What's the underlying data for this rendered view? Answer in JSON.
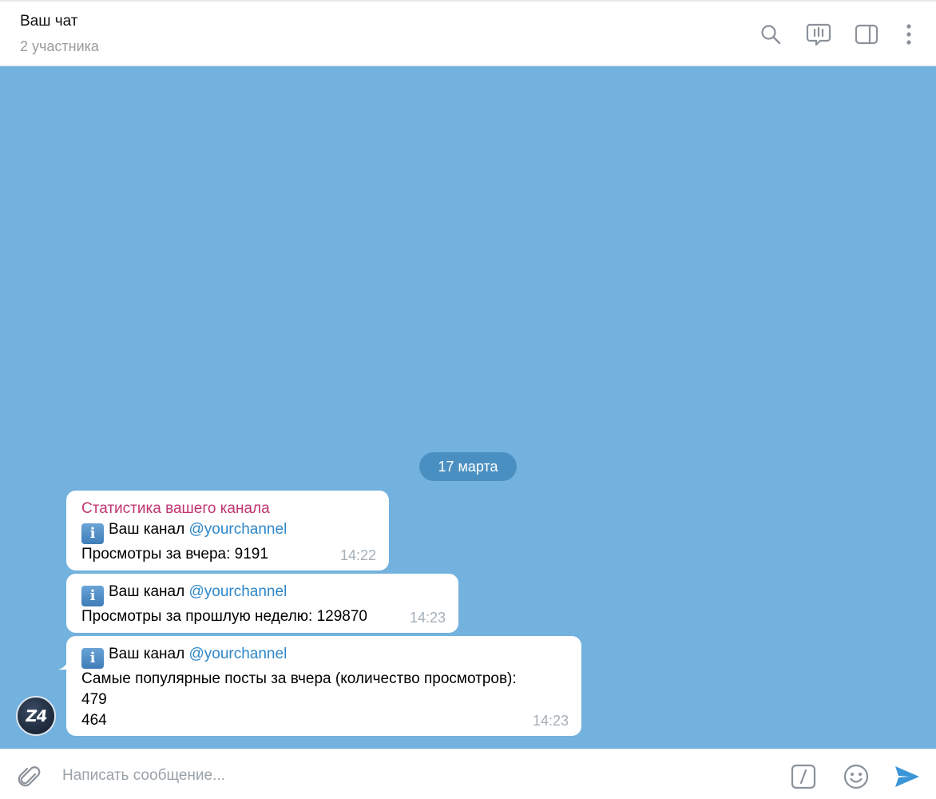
{
  "header": {
    "title": "Ваш чат",
    "subtitle": "2 участника",
    "icons": [
      "search-icon",
      "voice-chat-icon",
      "sidebar-toggle-icon",
      "more-icon"
    ]
  },
  "chat": {
    "background_color": "#73b2de",
    "date_label": "17 марта",
    "avatar_text": "Z4",
    "messages": [
      {
        "sender": "Статистика вашего канала",
        "lines": [
          {
            "prefix": "Ваш канал ",
            "link": "@yourchannel"
          },
          {
            "text": "Просмотры за вчера: 9191"
          }
        ],
        "time": "14:22"
      },
      {
        "lines": [
          {
            "prefix": "Ваш канал ",
            "link": "@yourchannel"
          },
          {
            "text": "Просмотры за прошлую неделю: 129870"
          }
        ],
        "time": "14:23"
      },
      {
        "lines": [
          {
            "prefix": "Ваш канал ",
            "link": "@yourchannel"
          },
          {
            "text": "Самые популярные посты за вчера (количество просмотров):"
          },
          {
            "text": "479"
          },
          {
            "text": "464"
          }
        ],
        "time": "14:23"
      }
    ]
  },
  "composer": {
    "placeholder": "Написать сообщение...",
    "icons": [
      "attach-icon",
      "commands-icon",
      "emoji-icon",
      "send-icon"
    ]
  },
  "colors": {
    "accent": "#2d86c8",
    "sender_name": "#c2336f",
    "date_pill": "#4a8fc2",
    "timestamp": "#a4afb8"
  }
}
